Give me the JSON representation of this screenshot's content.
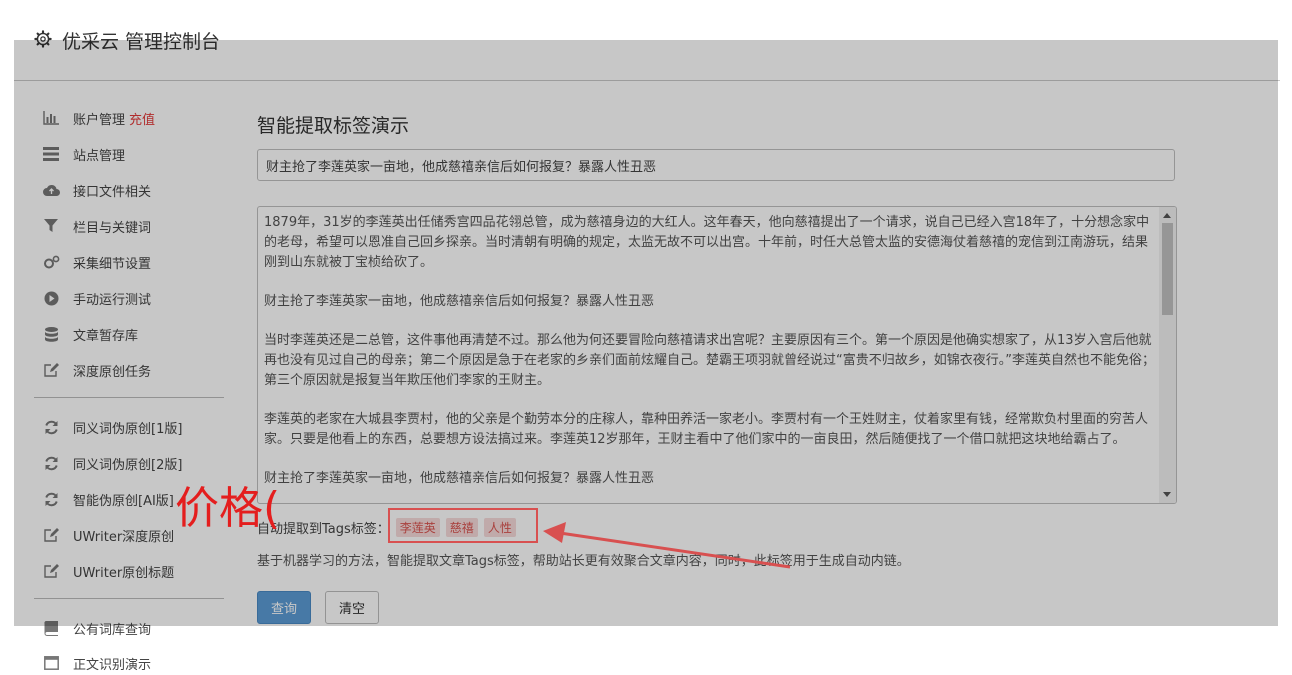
{
  "header": {
    "title": "优采云 管理控制台",
    "icon": "gear-icon"
  },
  "sidebar": {
    "items": [
      {
        "label": "账户管理",
        "accent": "充值",
        "icon": "bar-chart-icon"
      },
      {
        "label": "站点管理",
        "icon": "list-icon"
      },
      {
        "label": "接口文件相关",
        "icon": "cloud-upload-icon"
      },
      {
        "label": "栏目与关键词",
        "icon": "filter-icon"
      },
      {
        "label": "采集细节设置",
        "icon": "gears-icon"
      },
      {
        "label": "手动运行测试",
        "icon": "play-icon"
      },
      {
        "label": "文章暂存库",
        "icon": "database-icon"
      },
      {
        "label": "深度原创任务",
        "icon": "edit-icon"
      },
      {
        "label": "同义词伪原创[1版]",
        "icon": "refresh-icon"
      },
      {
        "label": "同义词伪原创[2版]",
        "icon": "refresh-icon"
      },
      {
        "label": "智能伪原创[AI版]",
        "icon": "refresh-icon"
      },
      {
        "label": "UWriter深度原创",
        "icon": "edit-icon"
      },
      {
        "label": "UWriter原创标题",
        "icon": "edit-icon"
      },
      {
        "label": "公有词库查询",
        "icon": "book-icon"
      },
      {
        "label": "正文识别演示",
        "icon": "window-icon"
      }
    ]
  },
  "main": {
    "title": "智能提取标签演示",
    "title_input_value": "财主抢了李莲英家一亩地，他成慈禧亲信后如何报复？暴露人性丑恶",
    "content_paragraphs": [
      "1879年，31岁的李莲英出任储秀宫四品花翎总管，成为慈禧身边的大红人。这年春天，他向慈禧提出了一个请求，说自己已经入宫18年了，十分想念家中的老母，希望可以恩准自己回乡探亲。当时清朝有明确的规定，太监无故不可以出宫。十年前，时任大总管太监的安德海仗着慈禧的宠信到江南游玩，结果刚到山东就被丁宝桢给砍了。",
      "财主抢了李莲英家一亩地，他成慈禧亲信后如何报复？暴露人性丑恶",
      "当时李莲英还是二总管，这件事他再清楚不过。那么他为何还要冒险向慈禧请求出宫呢？主要原因有三个。第一个原因是他确实想家了，从13岁入宫后他就再也没有见过自己的母亲；第二个原因是急于在老家的乡亲们面前炫耀自己。楚霸王项羽就曾经说过“富贵不归故乡，如锦衣夜行。”李莲英自然也不能免俗；第三个原因就是报复当年欺压他们李家的王财主。",
      "李莲英的老家在大城县李贾村，他的父亲是个勤劳本分的庄稼人，靠种田养活一家老小。李贾村有一个王姓财主，仗着家里有钱，经常欺负村里面的穷苦人家。只要是他看上的东西，总要想方设法搞过来。李莲英12岁那年，王财主看中了他们家中的一亩良田，然后随便找了一个借口就把这块地给霸占了。",
      "财主抢了李莲英家一亩地，他成慈禧亲信后如何报复？暴露人性丑恶"
    ],
    "tags_label": "自动提取到Tags标签：",
    "tags": [
      "李莲英",
      "慈禧",
      "人性"
    ],
    "description": "基于机器学习的方法，智能提取文章Tags标签，帮助站长更有效聚合文章内容，同时，此标签用于生成自动内链。",
    "query_button": "查询",
    "clear_button": "清空"
  },
  "annotation": {
    "text": "价格(",
    "color": "#e41e1e"
  }
}
